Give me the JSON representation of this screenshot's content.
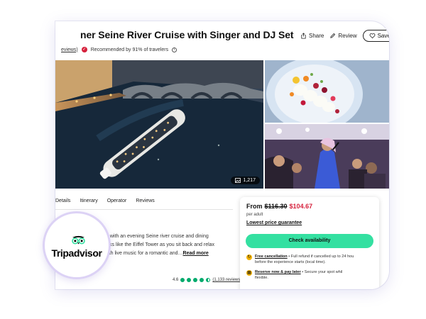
{
  "listing": {
    "title": "ner Seine River Cruise with Singer and DJ Set",
    "reviews_link": "eviews)",
    "recommendation": "Recommended by 91% of travelers",
    "actions": {
      "share": "Share",
      "review": "Review",
      "save": "Save"
    }
  },
  "gallery": {
    "photo_count": "1,217"
  },
  "tabs": [
    "Details",
    "Itinerary",
    "Operator",
    "Reviews"
  ],
  "description": {
    "lines": [
      "tive with an evening Seine river cruise and dining",
      "marks like the Eiffel Tower as you sit back and relax",
      "ll with live music for a romantic and"
    ],
    "ellipsis": "…",
    "read_more": "Read more"
  },
  "rating": {
    "score": "4.6",
    "count": "(1,133 reviews)",
    "stars": 4.5,
    "color": "#00aa6c"
  },
  "booking": {
    "from": "From",
    "old_price": "$116.30",
    "new_price": "$104.67",
    "per": "per adult",
    "lowest_price": "Lowest price guarantee",
    "cta": "Check availability",
    "cta_color": "#34e0a1",
    "features": [
      {
        "title": "Free cancellation",
        "text": "• Full refund if cancelled up to 24 hou",
        "text2": "before the experience starts (local time)."
      },
      {
        "title": "Reserve now & pay later",
        "text": "• Secure your spot whil",
        "text2": "flexible."
      }
    ]
  },
  "brand": {
    "name": "Tripadvisor",
    "icon": "owl-logo-icon"
  }
}
